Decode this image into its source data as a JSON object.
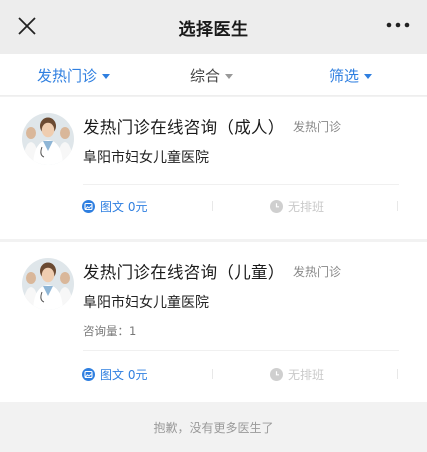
{
  "header": {
    "title": "选择医生",
    "close_icon": "close-icon",
    "more_icon": "more-icon"
  },
  "filters": [
    {
      "label": "发热门诊",
      "active": true
    },
    {
      "label": "综合",
      "active": false
    },
    {
      "label": "筛选",
      "active": true
    }
  ],
  "doctors": [
    {
      "name": "发热门诊在线咨询（成人）",
      "department": "发热门诊",
      "hospital": "阜阳市妇女儿童医院",
      "consult_count": "",
      "service_text": "图文 0元",
      "service_schedule": "无排班"
    },
    {
      "name": "发热门诊在线咨询（儿童）",
      "department": "发热门诊",
      "hospital": "阜阳市妇女儿童医院",
      "consult_count": "咨询量：1",
      "service_text": "图文 0元",
      "service_schedule": "无排班"
    }
  ],
  "footer": {
    "text": "抱歉，没有更多医生了"
  },
  "colors": {
    "accent": "#2f7fe0",
    "topbar_bg": "#ededed",
    "page_bg": "#f2f2f2"
  }
}
